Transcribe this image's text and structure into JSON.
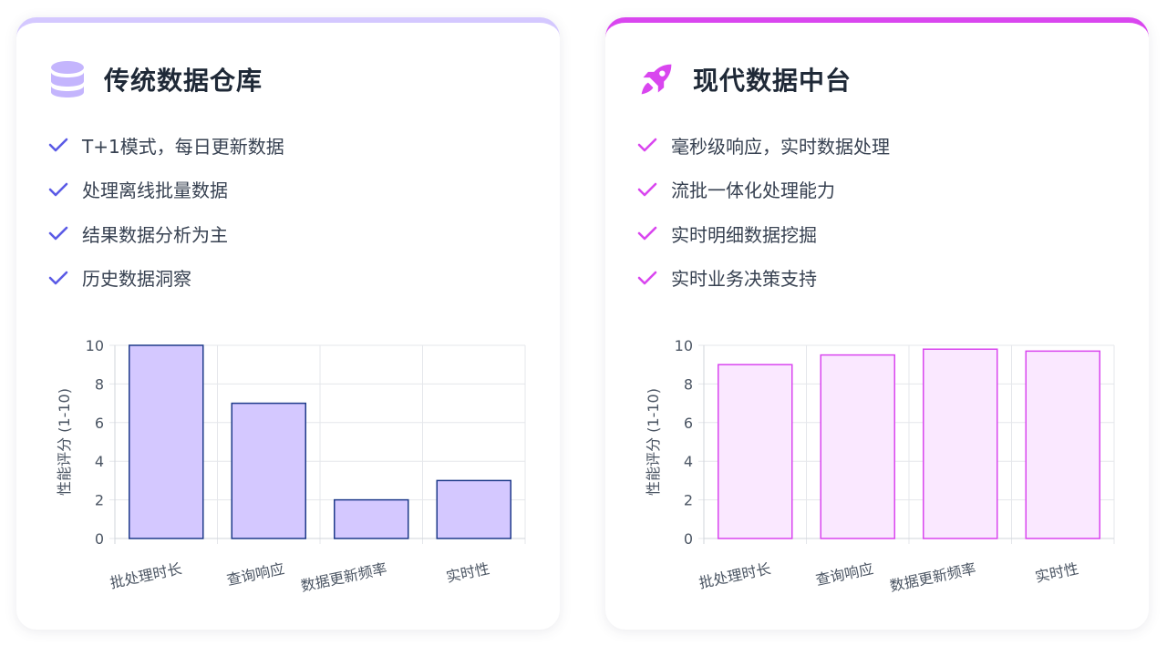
{
  "cards": [
    {
      "id": "traditional",
      "title": "传统数据仓库",
      "icon": "database-icon",
      "accent": "#4f46e5",
      "icon_color": "#c4b5fd",
      "check_color": "#5b5be6",
      "features": [
        "T+1模式，每日更新数据",
        "处理离线批量数据",
        "结果数据分析为主",
        "历史数据洞察"
      ]
    },
    {
      "id": "modern",
      "title": "现代数据中台",
      "icon": "rocket-icon",
      "accent": "#d946ef",
      "icon_color": "#d946ef",
      "check_color": "#d946ef",
      "features": [
        "毫秒级响应，实时数据处理",
        "流批一体化处理能力",
        "实时明细数据挖掘",
        "实时业务决策支持"
      ]
    }
  ],
  "chart_data": [
    {
      "type": "bar",
      "categories": [
        "批处理时长",
        "查询响应",
        "数据更新频率",
        "实时性"
      ],
      "values": [
        10,
        7,
        2,
        3
      ],
      "ylabel": "性能评分 (1-10)",
      "ylim": [
        0,
        10
      ],
      "yticks": [
        0,
        2,
        4,
        6,
        8,
        10
      ],
      "grid": true,
      "bar_fill": "#d4c8ff",
      "bar_stroke": "#1e3a8a"
    },
    {
      "type": "bar",
      "categories": [
        "批处理时长",
        "查询响应",
        "数据更新频率",
        "实时性"
      ],
      "values": [
        9,
        9.5,
        9.8,
        9.7
      ],
      "ylabel": "性能评分 (1-10)",
      "ylim": [
        0,
        10
      ],
      "yticks": [
        0,
        2,
        4,
        6,
        8,
        10
      ],
      "grid": true,
      "bar_fill": "#fae8ff",
      "bar_stroke": "#d946ef"
    }
  ]
}
